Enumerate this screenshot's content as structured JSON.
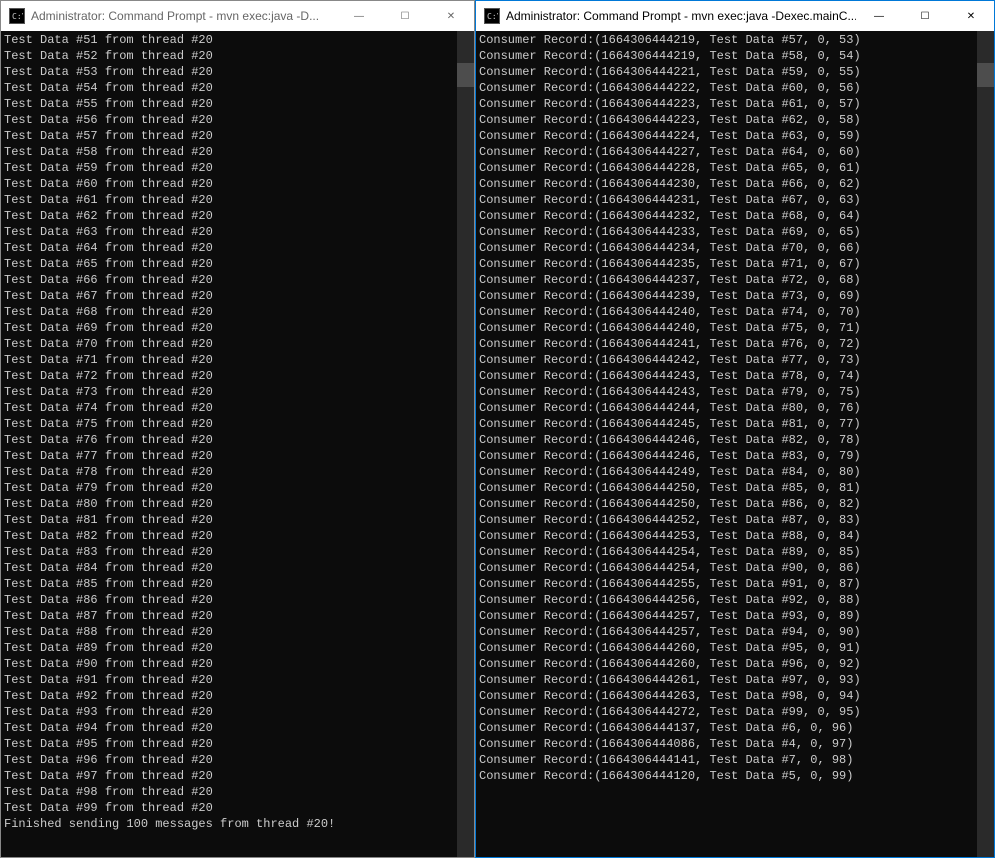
{
  "leftWindow": {
    "title": "Administrator: Command Prompt - mvn  exec:java -D...",
    "lines": [
      "Test Data #51 from thread #20",
      "Test Data #52 from thread #20",
      "Test Data #53 from thread #20",
      "Test Data #54 from thread #20",
      "Test Data #55 from thread #20",
      "Test Data #56 from thread #20",
      "Test Data #57 from thread #20",
      "Test Data #58 from thread #20",
      "Test Data #59 from thread #20",
      "Test Data #60 from thread #20",
      "Test Data #61 from thread #20",
      "Test Data #62 from thread #20",
      "Test Data #63 from thread #20",
      "Test Data #64 from thread #20",
      "Test Data #65 from thread #20",
      "Test Data #66 from thread #20",
      "Test Data #67 from thread #20",
      "Test Data #68 from thread #20",
      "Test Data #69 from thread #20",
      "Test Data #70 from thread #20",
      "Test Data #71 from thread #20",
      "Test Data #72 from thread #20",
      "Test Data #73 from thread #20",
      "Test Data #74 from thread #20",
      "Test Data #75 from thread #20",
      "Test Data #76 from thread #20",
      "Test Data #77 from thread #20",
      "Test Data #78 from thread #20",
      "Test Data #79 from thread #20",
      "Test Data #80 from thread #20",
      "Test Data #81 from thread #20",
      "Test Data #82 from thread #20",
      "Test Data #83 from thread #20",
      "Test Data #84 from thread #20",
      "Test Data #85 from thread #20",
      "Test Data #86 from thread #20",
      "Test Data #87 from thread #20",
      "Test Data #88 from thread #20",
      "Test Data #89 from thread #20",
      "Test Data #90 from thread #20",
      "Test Data #91 from thread #20",
      "Test Data #92 from thread #20",
      "Test Data #93 from thread #20",
      "Test Data #94 from thread #20",
      "Test Data #95 from thread #20",
      "Test Data #96 from thread #20",
      "Test Data #97 from thread #20",
      "Test Data #98 from thread #20",
      "Test Data #99 from thread #20",
      "Finished sending 100 messages from thread #20!"
    ]
  },
  "rightWindow": {
    "title": "Administrator: Command Prompt - mvn  exec:java -Dexec.mainC...",
    "lines": [
      "Consumer Record:(1664306444219, Test Data #57, 0, 53)",
      "Consumer Record:(1664306444219, Test Data #58, 0, 54)",
      "Consumer Record:(1664306444221, Test Data #59, 0, 55)",
      "Consumer Record:(1664306444222, Test Data #60, 0, 56)",
      "Consumer Record:(1664306444223, Test Data #61, 0, 57)",
      "Consumer Record:(1664306444223, Test Data #62, 0, 58)",
      "Consumer Record:(1664306444224, Test Data #63, 0, 59)",
      "Consumer Record:(1664306444227, Test Data #64, 0, 60)",
      "Consumer Record:(1664306444228, Test Data #65, 0, 61)",
      "Consumer Record:(1664306444230, Test Data #66, 0, 62)",
      "Consumer Record:(1664306444231, Test Data #67, 0, 63)",
      "Consumer Record:(1664306444232, Test Data #68, 0, 64)",
      "Consumer Record:(1664306444233, Test Data #69, 0, 65)",
      "Consumer Record:(1664306444234, Test Data #70, 0, 66)",
      "Consumer Record:(1664306444235, Test Data #71, 0, 67)",
      "Consumer Record:(1664306444237, Test Data #72, 0, 68)",
      "Consumer Record:(1664306444239, Test Data #73, 0, 69)",
      "Consumer Record:(1664306444240, Test Data #74, 0, 70)",
      "Consumer Record:(1664306444240, Test Data #75, 0, 71)",
      "Consumer Record:(1664306444241, Test Data #76, 0, 72)",
      "Consumer Record:(1664306444242, Test Data #77, 0, 73)",
      "Consumer Record:(1664306444243, Test Data #78, 0, 74)",
      "Consumer Record:(1664306444243, Test Data #79, 0, 75)",
      "Consumer Record:(1664306444244, Test Data #80, 0, 76)",
      "Consumer Record:(1664306444245, Test Data #81, 0, 77)",
      "Consumer Record:(1664306444246, Test Data #82, 0, 78)",
      "Consumer Record:(1664306444246, Test Data #83, 0, 79)",
      "Consumer Record:(1664306444249, Test Data #84, 0, 80)",
      "Consumer Record:(1664306444250, Test Data #85, 0, 81)",
      "Consumer Record:(1664306444250, Test Data #86, 0, 82)",
      "Consumer Record:(1664306444252, Test Data #87, 0, 83)",
      "Consumer Record:(1664306444253, Test Data #88, 0, 84)",
      "Consumer Record:(1664306444254, Test Data #89, 0, 85)",
      "Consumer Record:(1664306444254, Test Data #90, 0, 86)",
      "Consumer Record:(1664306444255, Test Data #91, 0, 87)",
      "Consumer Record:(1664306444256, Test Data #92, 0, 88)",
      "Consumer Record:(1664306444257, Test Data #93, 0, 89)",
      "Consumer Record:(1664306444257, Test Data #94, 0, 90)",
      "Consumer Record:(1664306444260, Test Data #95, 0, 91)",
      "Consumer Record:(1664306444260, Test Data #96, 0, 92)",
      "Consumer Record:(1664306444261, Test Data #97, 0, 93)",
      "Consumer Record:(1664306444263, Test Data #98, 0, 94)",
      "Consumer Record:(1664306444272, Test Data #99, 0, 95)",
      "Consumer Record:(1664306444137, Test Data #6, 0, 96)",
      "Consumer Record:(1664306444086, Test Data #4, 0, 97)",
      "Consumer Record:(1664306444141, Test Data #7, 0, 98)",
      "Consumer Record:(1664306444120, Test Data #5, 0, 99)"
    ]
  },
  "controls": {
    "minimize": "—",
    "maximize": "☐",
    "close": "✕"
  }
}
